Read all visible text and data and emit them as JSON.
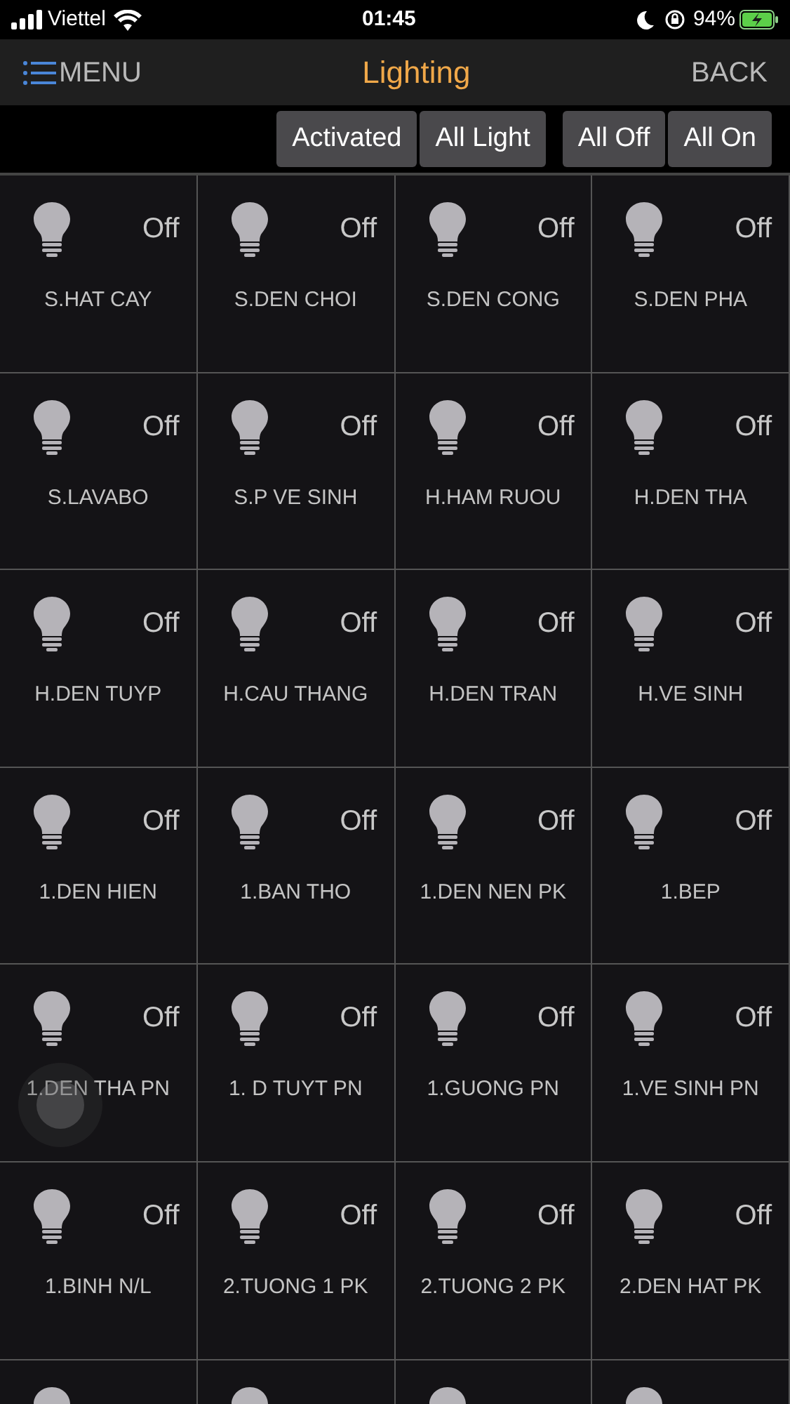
{
  "status_bar": {
    "carrier": "Viettel",
    "time": "01:45",
    "battery": "94%"
  },
  "header": {
    "menu": "MENU",
    "title": "Lighting",
    "back": "BACK"
  },
  "filters": [
    {
      "label": "Activated"
    },
    {
      "label": "All Light"
    }
  ],
  "actions": [
    {
      "label": "All Off"
    },
    {
      "label": "All On"
    }
  ],
  "lights": [
    {
      "name": "S.HAT CAY",
      "status": "Off",
      "on": false
    },
    {
      "name": "S.DEN CHOI",
      "status": "Off",
      "on": false
    },
    {
      "name": "S.DEN CONG",
      "status": "Off",
      "on": false
    },
    {
      "name": "S.DEN PHA",
      "status": "Off",
      "on": false
    },
    {
      "name": "S.LAVABO",
      "status": "Off",
      "on": false
    },
    {
      "name": "S.P VE SINH",
      "status": "Off",
      "on": false
    },
    {
      "name": "H.HAM RUOU",
      "status": "Off",
      "on": false
    },
    {
      "name": "H.DEN THA",
      "status": "Off",
      "on": false
    },
    {
      "name": "H.DEN TUYP",
      "status": "Off",
      "on": false
    },
    {
      "name": "H.CAU THANG",
      "status": "Off",
      "on": false
    },
    {
      "name": "H.DEN TRAN",
      "status": "Off",
      "on": false
    },
    {
      "name": "H.VE SINH",
      "status": "Off",
      "on": false
    },
    {
      "name": "1.DEN HIEN",
      "status": "Off",
      "on": false
    },
    {
      "name": "1.BAN THO",
      "status": "Off",
      "on": false
    },
    {
      "name": "1.DEN NEN PK",
      "status": "Off",
      "on": false
    },
    {
      "name": "1.BEP",
      "status": "Off",
      "on": false
    },
    {
      "name": "1.DEN THA PN",
      "status": "Off",
      "on": false
    },
    {
      "name": "1. D TUYT PN",
      "status": "Off",
      "on": false
    },
    {
      "name": "1.GUONG PN",
      "status": "Off",
      "on": false
    },
    {
      "name": "1.VE SINH PN",
      "status": "Off",
      "on": false
    },
    {
      "name": "1.BINH N/L",
      "status": "Off",
      "on": false
    },
    {
      "name": "2.TUONG 1 PK",
      "status": "Off",
      "on": false
    },
    {
      "name": "2.TUONG 2 PK",
      "status": "Off",
      "on": false
    },
    {
      "name": "2.DEN HAT PK",
      "status": "Off",
      "on": false
    }
  ],
  "cut_row": [
    {
      "on": false
    },
    {
      "on": false
    },
    {
      "on": false
    },
    {
      "on": false
    }
  ]
}
